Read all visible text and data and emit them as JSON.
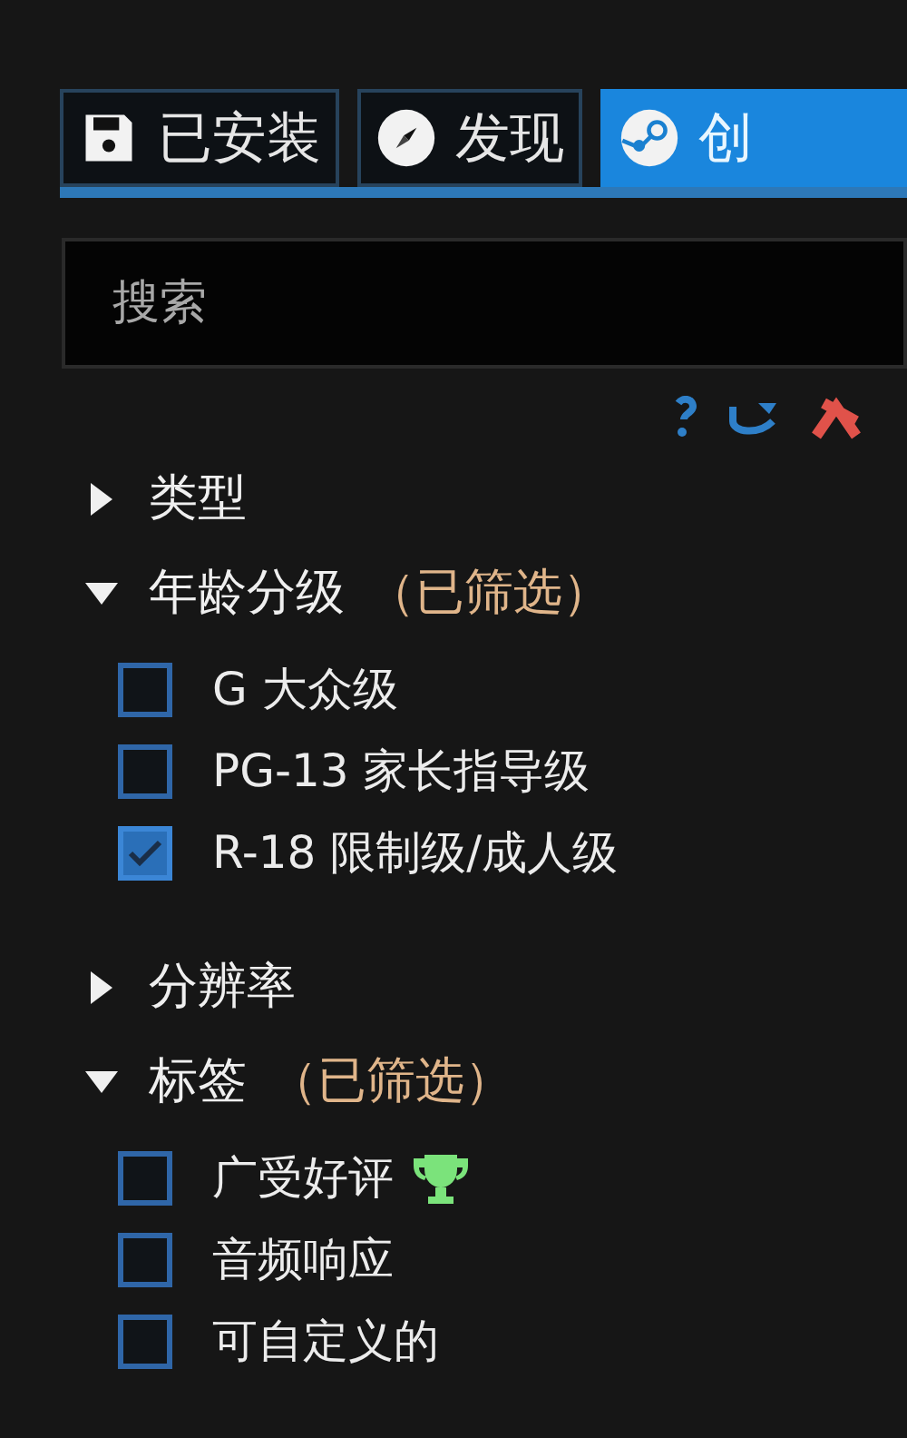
{
  "tabs": [
    {
      "label": "已安装",
      "kind": "disk",
      "selected": false
    },
    {
      "label": "发现",
      "kind": "compass",
      "selected": false
    },
    {
      "label": "创",
      "kind": "steam",
      "selected": true
    }
  ],
  "search": {
    "placeholder": "搜索"
  },
  "filters": [
    {
      "label": "类型",
      "expanded": false
    },
    {
      "label": "年龄分级",
      "expanded": true,
      "note": "（已筛选）",
      "options": [
        {
          "label": "G 大众级",
          "checked": false,
          "kind": "plain"
        },
        {
          "label": "PG-13 家长指导级",
          "checked": false,
          "kind": "plain"
        },
        {
          "label": "R-18 限制级/成人级",
          "checked": true,
          "kind": "plain"
        }
      ]
    },
    {
      "label": "分辨率",
      "expanded": false
    },
    {
      "label": "标签",
      "expanded": true,
      "note": "（已筛选）",
      "options": [
        {
          "label": "广受好评",
          "checked": false,
          "kind": "award"
        },
        {
          "label": "音频响应",
          "checked": false,
          "kind": "plain"
        },
        {
          "label": "可自定义的",
          "checked": false,
          "kind": "plain"
        }
      ]
    }
  ]
}
